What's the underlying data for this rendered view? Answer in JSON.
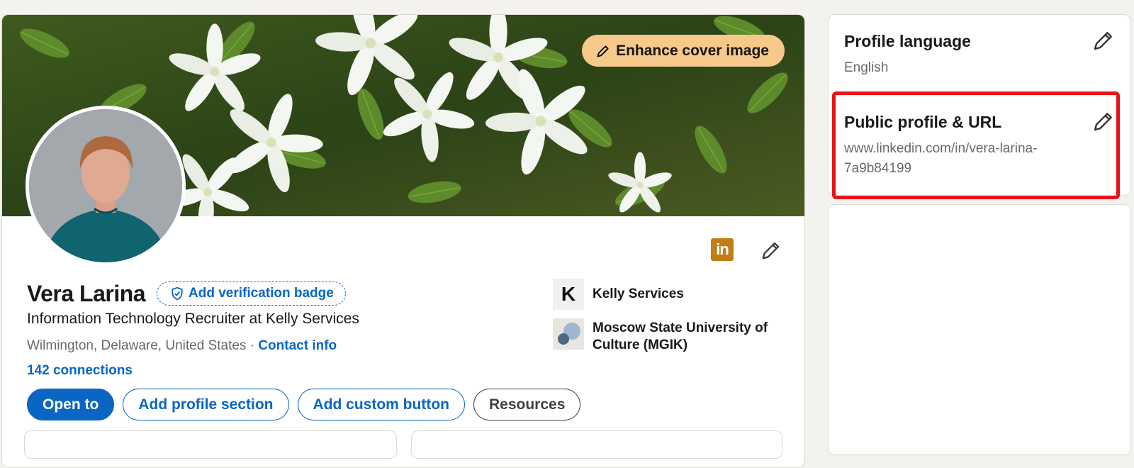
{
  "cover": {
    "enhance_label": "Enhance cover image"
  },
  "intro": {
    "name": "Vera Larina",
    "verification_label": "Add verification badge",
    "headline": "Information Technology Recruiter at Kelly Services",
    "location": "Wilmington, Delaware, United States",
    "separator": " · ",
    "contact_label": "Contact info",
    "connections": "142 connections",
    "linkedin_badge": "in"
  },
  "actions": {
    "open_to": "Open to",
    "add_section": "Add profile section",
    "add_custom": "Add custom button",
    "resources": "Resources"
  },
  "organizations": [
    {
      "name": "Kelly Services",
      "logo_letter": "K"
    },
    {
      "name": "Moscow State University of Culture (MGIK)"
    }
  ],
  "sidebar": {
    "profile_language": {
      "title": "Profile language",
      "value": "English"
    },
    "public_profile": {
      "title": "Public profile & URL",
      "url_line1": "www.linkedin.com/in/vera-larina-",
      "url_line2": "7a9b84199"
    }
  },
  "colors": {
    "accent": "#0a66c2",
    "enhance_bg": "#f6c98b",
    "highlight": "#e8131a",
    "linkedin_badge": "#c37d16"
  }
}
